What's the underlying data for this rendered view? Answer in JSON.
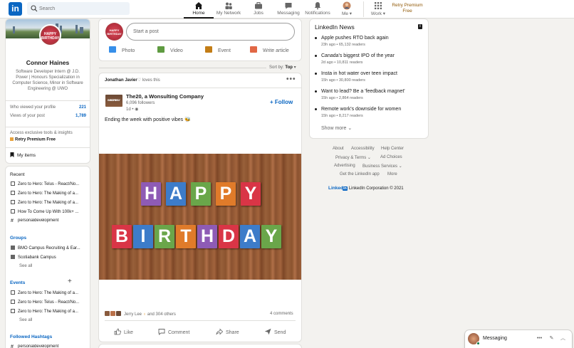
{
  "colors": {
    "brand": "#0a66c2",
    "premium": "#915907",
    "background": "#f3f2ef"
  },
  "nav": {
    "logo": "in",
    "search_placeholder": "Search",
    "items": [
      {
        "label": "Home",
        "icon": "home-icon"
      },
      {
        "label": "My Network",
        "icon": "network-icon"
      },
      {
        "label": "Jobs",
        "icon": "briefcase-icon"
      },
      {
        "label": "Messaging",
        "icon": "chat-icon"
      },
      {
        "label": "Notifications",
        "icon": "bell-icon"
      },
      {
        "label": "Me",
        "icon": "avatar-icon"
      },
      {
        "label": "Work",
        "icon": "grid-icon"
      }
    ],
    "premium_line1": "Retry Premium",
    "premium_line2": "Free"
  },
  "profile": {
    "avatar_text_top": "HAPPY",
    "avatar_text_bottom": "BIRTHDAY",
    "name": "Connor Haines",
    "headline": "Software Developer Intern @ J.D. Power | Honours Specialization in Computer Science, Minor in Software Engineering @ UWO",
    "stats": [
      {
        "label": "Who viewed your profile",
        "value": "221"
      },
      {
        "label": "Views of your post",
        "value": "1,789"
      }
    ],
    "access_text": "Access exclusive tools & insights",
    "retry_premium": "Retry Premium Free",
    "my_items": "My items"
  },
  "left": {
    "recent_header": "Recent",
    "recent": [
      "Zero to Hero: Telus - React/No...",
      "Zero to Hero: The Making of a...",
      "Zero to Hero: The Making of a...",
      "How To Come Up With 100k+ ...",
      "personaldevelopment"
    ],
    "groups_header": "Groups",
    "groups": [
      "BMO Campus Recruiting & Ear...",
      "Scotiabank Campus"
    ],
    "groups_see_all": "See all",
    "events_header": "Events",
    "events": [
      "Zero to Hero: The Making of a...",
      "Zero to Hero: Telus - React/No...",
      "Zero to Hero: The Making of a..."
    ],
    "events_see_all": "See all",
    "hashtags_header": "Followed Hashtags",
    "hashtags": [
      "personaldevelopment"
    ]
  },
  "share": {
    "placeholder": "Start a post",
    "actions": [
      {
        "label": "Photo",
        "color": "#378fe9"
      },
      {
        "label": "Video",
        "color": "#5f9b41"
      },
      {
        "label": "Event",
        "color": "#c37d16"
      },
      {
        "label": "Write article",
        "color": "#e16745"
      }
    ]
  },
  "sort": {
    "label": "Sort by:",
    "value": "Top"
  },
  "post": {
    "actor": "Jonathan Javier",
    "actor_action": "loves this",
    "company_thumb_top": "HAPPY",
    "company_thumb_bottom": "BIRTHDAY",
    "company": "The20, a Wonsulting Company",
    "followers": "6,096 followers",
    "time": "1d •",
    "follow_label": "+ Follow",
    "text": "Ending the week with positive vibes 🐝",
    "image_word1": "HAPPY",
    "image_word2": "BIRTHDAY",
    "reactions_text": "Jerry Lee",
    "reactions_tail": "and 304 others",
    "comments": "4 comments",
    "actions": [
      "Like",
      "Comment",
      "Share",
      "Send"
    ]
  },
  "news": {
    "title": "LinkedIn News",
    "items": [
      {
        "title": "Apple pushes RTO back again",
        "meta": "23h ago • 65,132 readers"
      },
      {
        "title": "Canada's biggest IPO of the year",
        "meta": "2d ago • 10,811 readers"
      },
      {
        "title": "Insta in hot water over teen impact",
        "meta": "15h ago • 30,800 readers"
      },
      {
        "title": "Want to lead? Be a 'feedback magnet'",
        "meta": "15h ago • 2,864 readers"
      },
      {
        "title": "Remote work's downside for women",
        "meta": "15h ago • 8,217 readers"
      }
    ],
    "show_more": "Show more"
  },
  "footer": {
    "links": [
      "About",
      "Accessibility",
      "Help Center",
      "Privacy & Terms",
      "Ad Choices",
      "Advertising",
      "Business Services",
      "Get the LinkedIn app",
      "More"
    ],
    "brand_word": "Linked",
    "brand_in": "in",
    "copyright": "LinkedIn Corporation © 2021"
  },
  "messaging": {
    "label": "Messaging"
  }
}
